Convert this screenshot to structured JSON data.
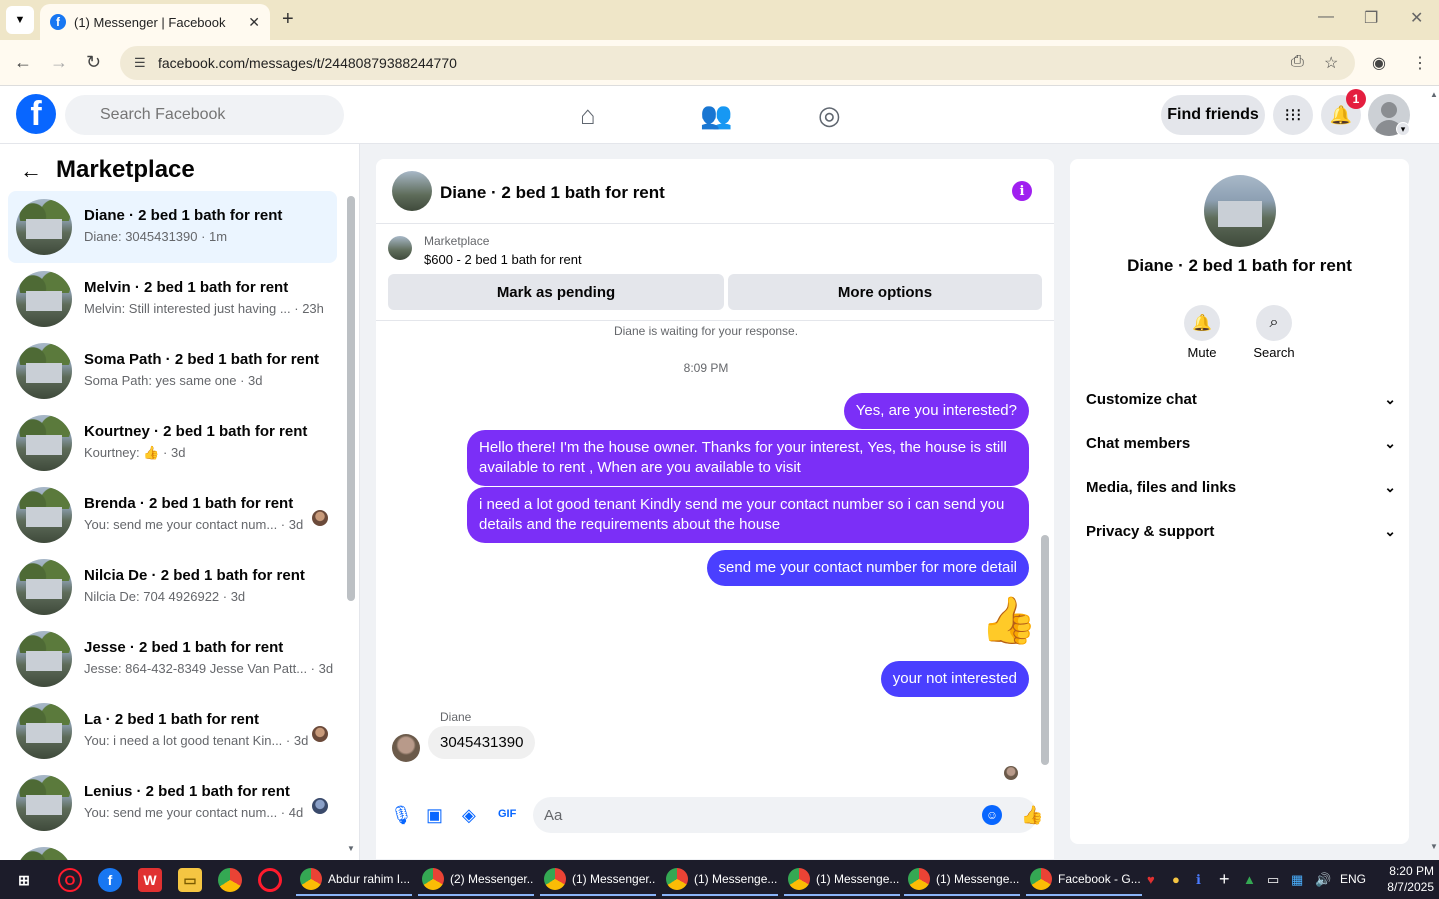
{
  "browser": {
    "tab_title": "(1) Messenger | Facebook",
    "url": "facebook.com/messages/t/24480879388244770"
  },
  "fb_header": {
    "search_placeholder": "Search Facebook",
    "find_friends": "Find friends",
    "notification_count": "1"
  },
  "left_panel": {
    "title": "Marketplace",
    "conversations": [
      {
        "name": "Diane · 2 bed 1 bath for rent",
        "preview": "Diane: 3045431390 · 1m",
        "active": true
      },
      {
        "name": "Melvin · 2 bed 1 bath for rent",
        "preview": "Melvin: Still interested just having ... · 23h"
      },
      {
        "name": "Soma Path · 2 bed 1 bath for rent",
        "preview": "Soma Path: yes same one · 3d"
      },
      {
        "name": "Kourtney · 2 bed 1 bath for rent",
        "preview": "Kourtney: 👍 · 3d"
      },
      {
        "name": "Brenda · 2 bed 1 bath for rent",
        "preview": "You: send me your contact num... · 3d"
      },
      {
        "name": "Nilcia De · 2 bed 1 bath for rent",
        "preview": "Nilcia De: 704 4926922 · 3d"
      },
      {
        "name": "Jesse · 2 bed 1 bath for rent",
        "preview": "Jesse: 864-432-8349 Jesse Van Patt... · 3d"
      },
      {
        "name": "La · 2 bed 1 bath for rent",
        "preview": "You: i need a lot good tenant Kin... · 3d"
      },
      {
        "name": "Lenius · 2 bed 1 bath for rent",
        "preview": "You: send me your contact num... · 4d"
      }
    ]
  },
  "chat": {
    "title": "Diane · 2 bed 1 bath for rent",
    "marketplace_label": "Marketplace",
    "listing": "$600 - 2 bed 1 bath for rent",
    "mark_pending": "Mark as pending",
    "more_options": "More options",
    "waiting_notice": "Diane is waiting for your response.",
    "timestamp": "8:09 PM",
    "messages": [
      {
        "text": "Yes, are you interested?"
      },
      {
        "text": "Hello there! I'm the house owner. Thanks for your interest, Yes, the house is still available to rent , When are you available to visit"
      },
      {
        "text": "i need a lot good tenant Kindly send me your contact number so i can send you details and the requirements about the house"
      },
      {
        "text": "send me your contact number for more detail"
      },
      {
        "text": "your not interested"
      }
    ],
    "incoming_sender": "Diane",
    "incoming_text": "3045431390",
    "composer_placeholder": "Aa"
  },
  "right_panel": {
    "name": "Diane · 2 bed 1 bath for rent",
    "mute_label": "Mute",
    "search_label": "Search",
    "sections": [
      "Customize chat",
      "Chat members",
      "Media, files and links",
      "Privacy & support"
    ]
  },
  "taskbar": {
    "apps": [
      "Abdur rahim I...",
      "(2) Messenger...",
      "(1) Messenger...",
      "(1) Messenge...",
      "(1) Messenge...",
      "(1) Messenge...",
      "Facebook - G..."
    ],
    "lang": "ENG",
    "time": "8:20 PM",
    "date": "8/7/2025"
  }
}
